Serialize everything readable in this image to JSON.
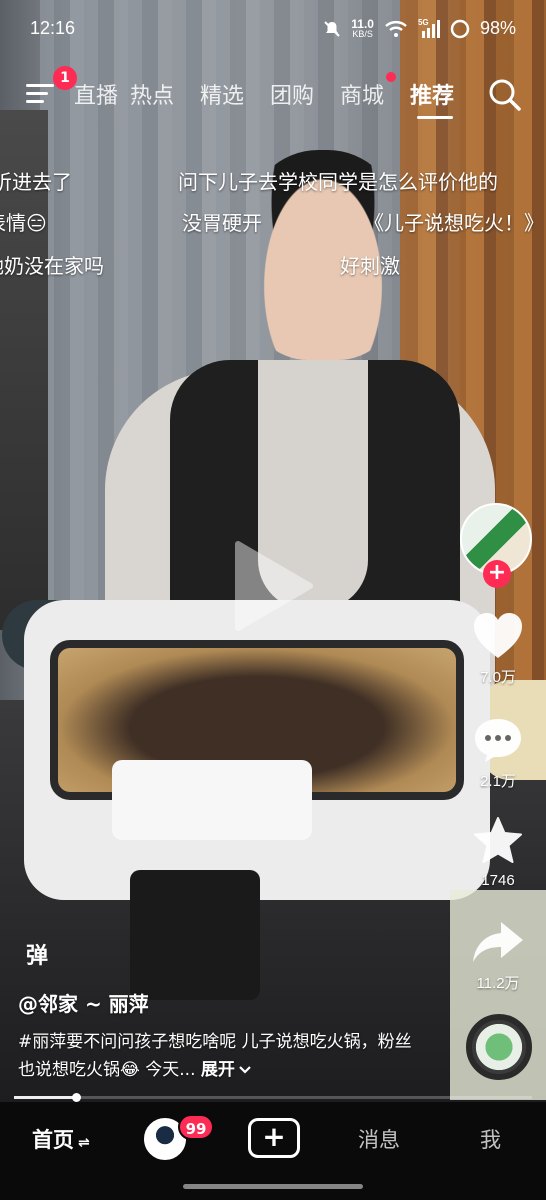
{
  "status_bar": {
    "time": "12:16",
    "net_speed_value": "11.0",
    "net_speed_unit": "KB/S",
    "network_type": "5G",
    "battery": "98%"
  },
  "top_nav": {
    "menu_badge": "1",
    "tabs": [
      {
        "label": "直播",
        "active": false
      },
      {
        "label": "热点",
        "active": false
      },
      {
        "label": "精选",
        "active": false
      },
      {
        "label": "团购",
        "active": false
      },
      {
        "label": "商城",
        "active": false,
        "dot": true
      },
      {
        "label": "推荐",
        "active": true
      }
    ]
  },
  "danmaku": [
    "听进去了",
    "问下儿子去学校同学是怎么评价他的",
    "表情😑",
    "没胃硬开",
    "《儿子说想吃火！》",
    "她奶没在家吗",
    "好刺激"
  ],
  "actions": {
    "likes": "7.0万",
    "comments": "2.1万",
    "favorites": "1746",
    "shares": "11.2万"
  },
  "caption": {
    "danmu_toggle": "弹",
    "author": "@邻家 ~ 丽萍",
    "description": "#丽萍要不问问孩子想吃啥呢 儿子说想吃火锅，粉丝也说想吃火锅😂 今天...",
    "expand_label": "展开"
  },
  "progress": {
    "fraction": 0.12
  },
  "bottom_tabs": {
    "home": "首页",
    "friends_badge": "99",
    "messages": "消息",
    "me": "我"
  },
  "colors": {
    "accent": "#fe2c55",
    "bar_bg": "#0a0a0a"
  }
}
